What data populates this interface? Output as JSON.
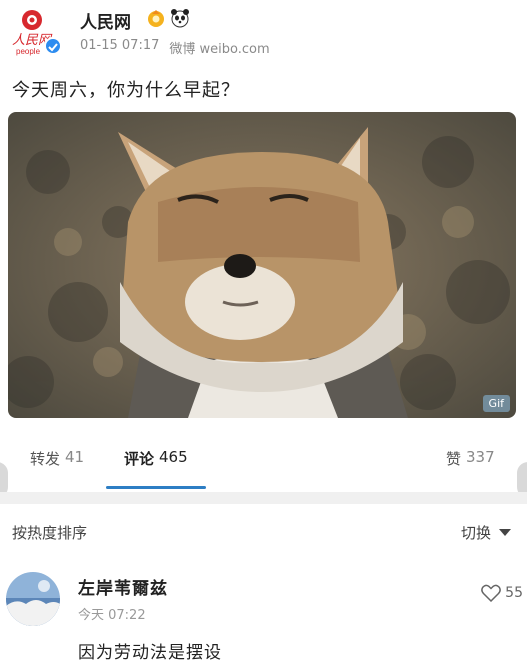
{
  "post": {
    "author": "人民网",
    "logo_text": "人民网",
    "logo_sub": "people",
    "time": "01-15 07:17",
    "source": "微博 weibo.com",
    "text": "今天周六，你为什么早起？",
    "media_badge": "Gif"
  },
  "tabs": [
    {
      "label": "转发",
      "count": "41"
    },
    {
      "label": "评论",
      "count": "465"
    },
    {
      "label": "赞",
      "count": "337"
    }
  ],
  "sort": {
    "label": "按热度排序",
    "switch_label": "切换"
  },
  "comment": {
    "author": "左岸苇爾兹",
    "time": "今天 07:22",
    "text": "因为劳动法是摆设",
    "likes": "55"
  },
  "colors": {
    "accent": "#2d7ec4",
    "logo_red": "#d7282e",
    "verified": "#2d8cf0"
  }
}
